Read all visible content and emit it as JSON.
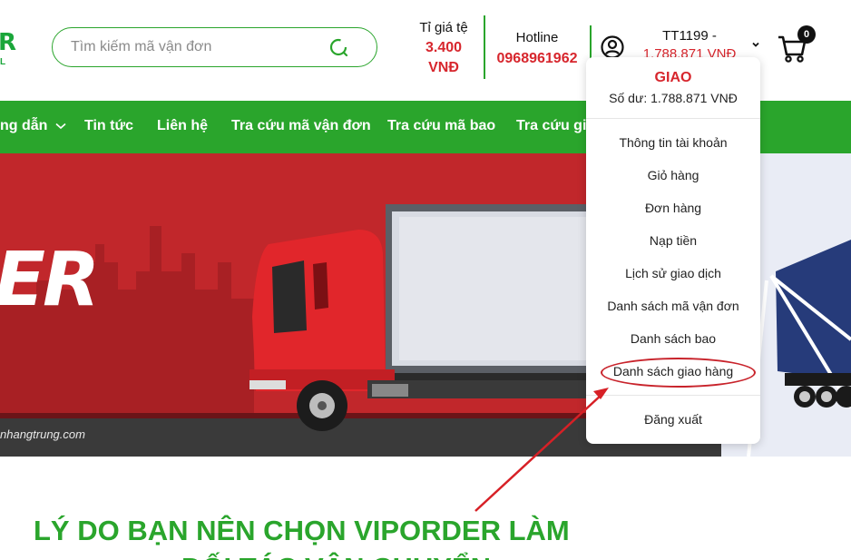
{
  "header": {
    "logo_text": "R",
    "logo_sub": "L",
    "search_placeholder": "Tìm kiếm mã vận đơn",
    "rate_label": "Tỉ giá tệ",
    "rate_value": "3.400",
    "rate_unit": "VNĐ",
    "hotline_label": "Hotline",
    "hotline_value": "0968961962",
    "account_code": "TT1199 -",
    "account_balance": "1.788.871 VNĐ",
    "cart_count": "0"
  },
  "nav": {
    "items": [
      "ng dẫn",
      "Tin tức",
      "Liên hệ",
      "Tra cứu mã vận đơn",
      "Tra cứu mã bao",
      "Tra cứu gia"
    ]
  },
  "banner": {
    "big_text": "ER",
    "url": "nhangtrung.com"
  },
  "dropdown": {
    "name": "GIAO",
    "balance": "Số dư: 1.788.871 VNĐ",
    "items": [
      "Thông tin tài khoản",
      "Giỏ hàng",
      "Đơn hàng",
      "Nạp tiền",
      "Lịch sử giao dịch",
      "Danh sách mã vận đơn",
      "Danh sách bao",
      "Danh sách giao hàng"
    ],
    "logout": "Đăng xuất"
  },
  "section": {
    "heading_line1": "LÝ DO BẠN NÊN CHỌN VIPORDER LÀM",
    "heading_line2": "ĐỐI TÁC VẬN CHUYỂN"
  },
  "colors": {
    "green": "#2aa52c",
    "red": "#d7262d",
    "banner_red": "#c1272b"
  }
}
